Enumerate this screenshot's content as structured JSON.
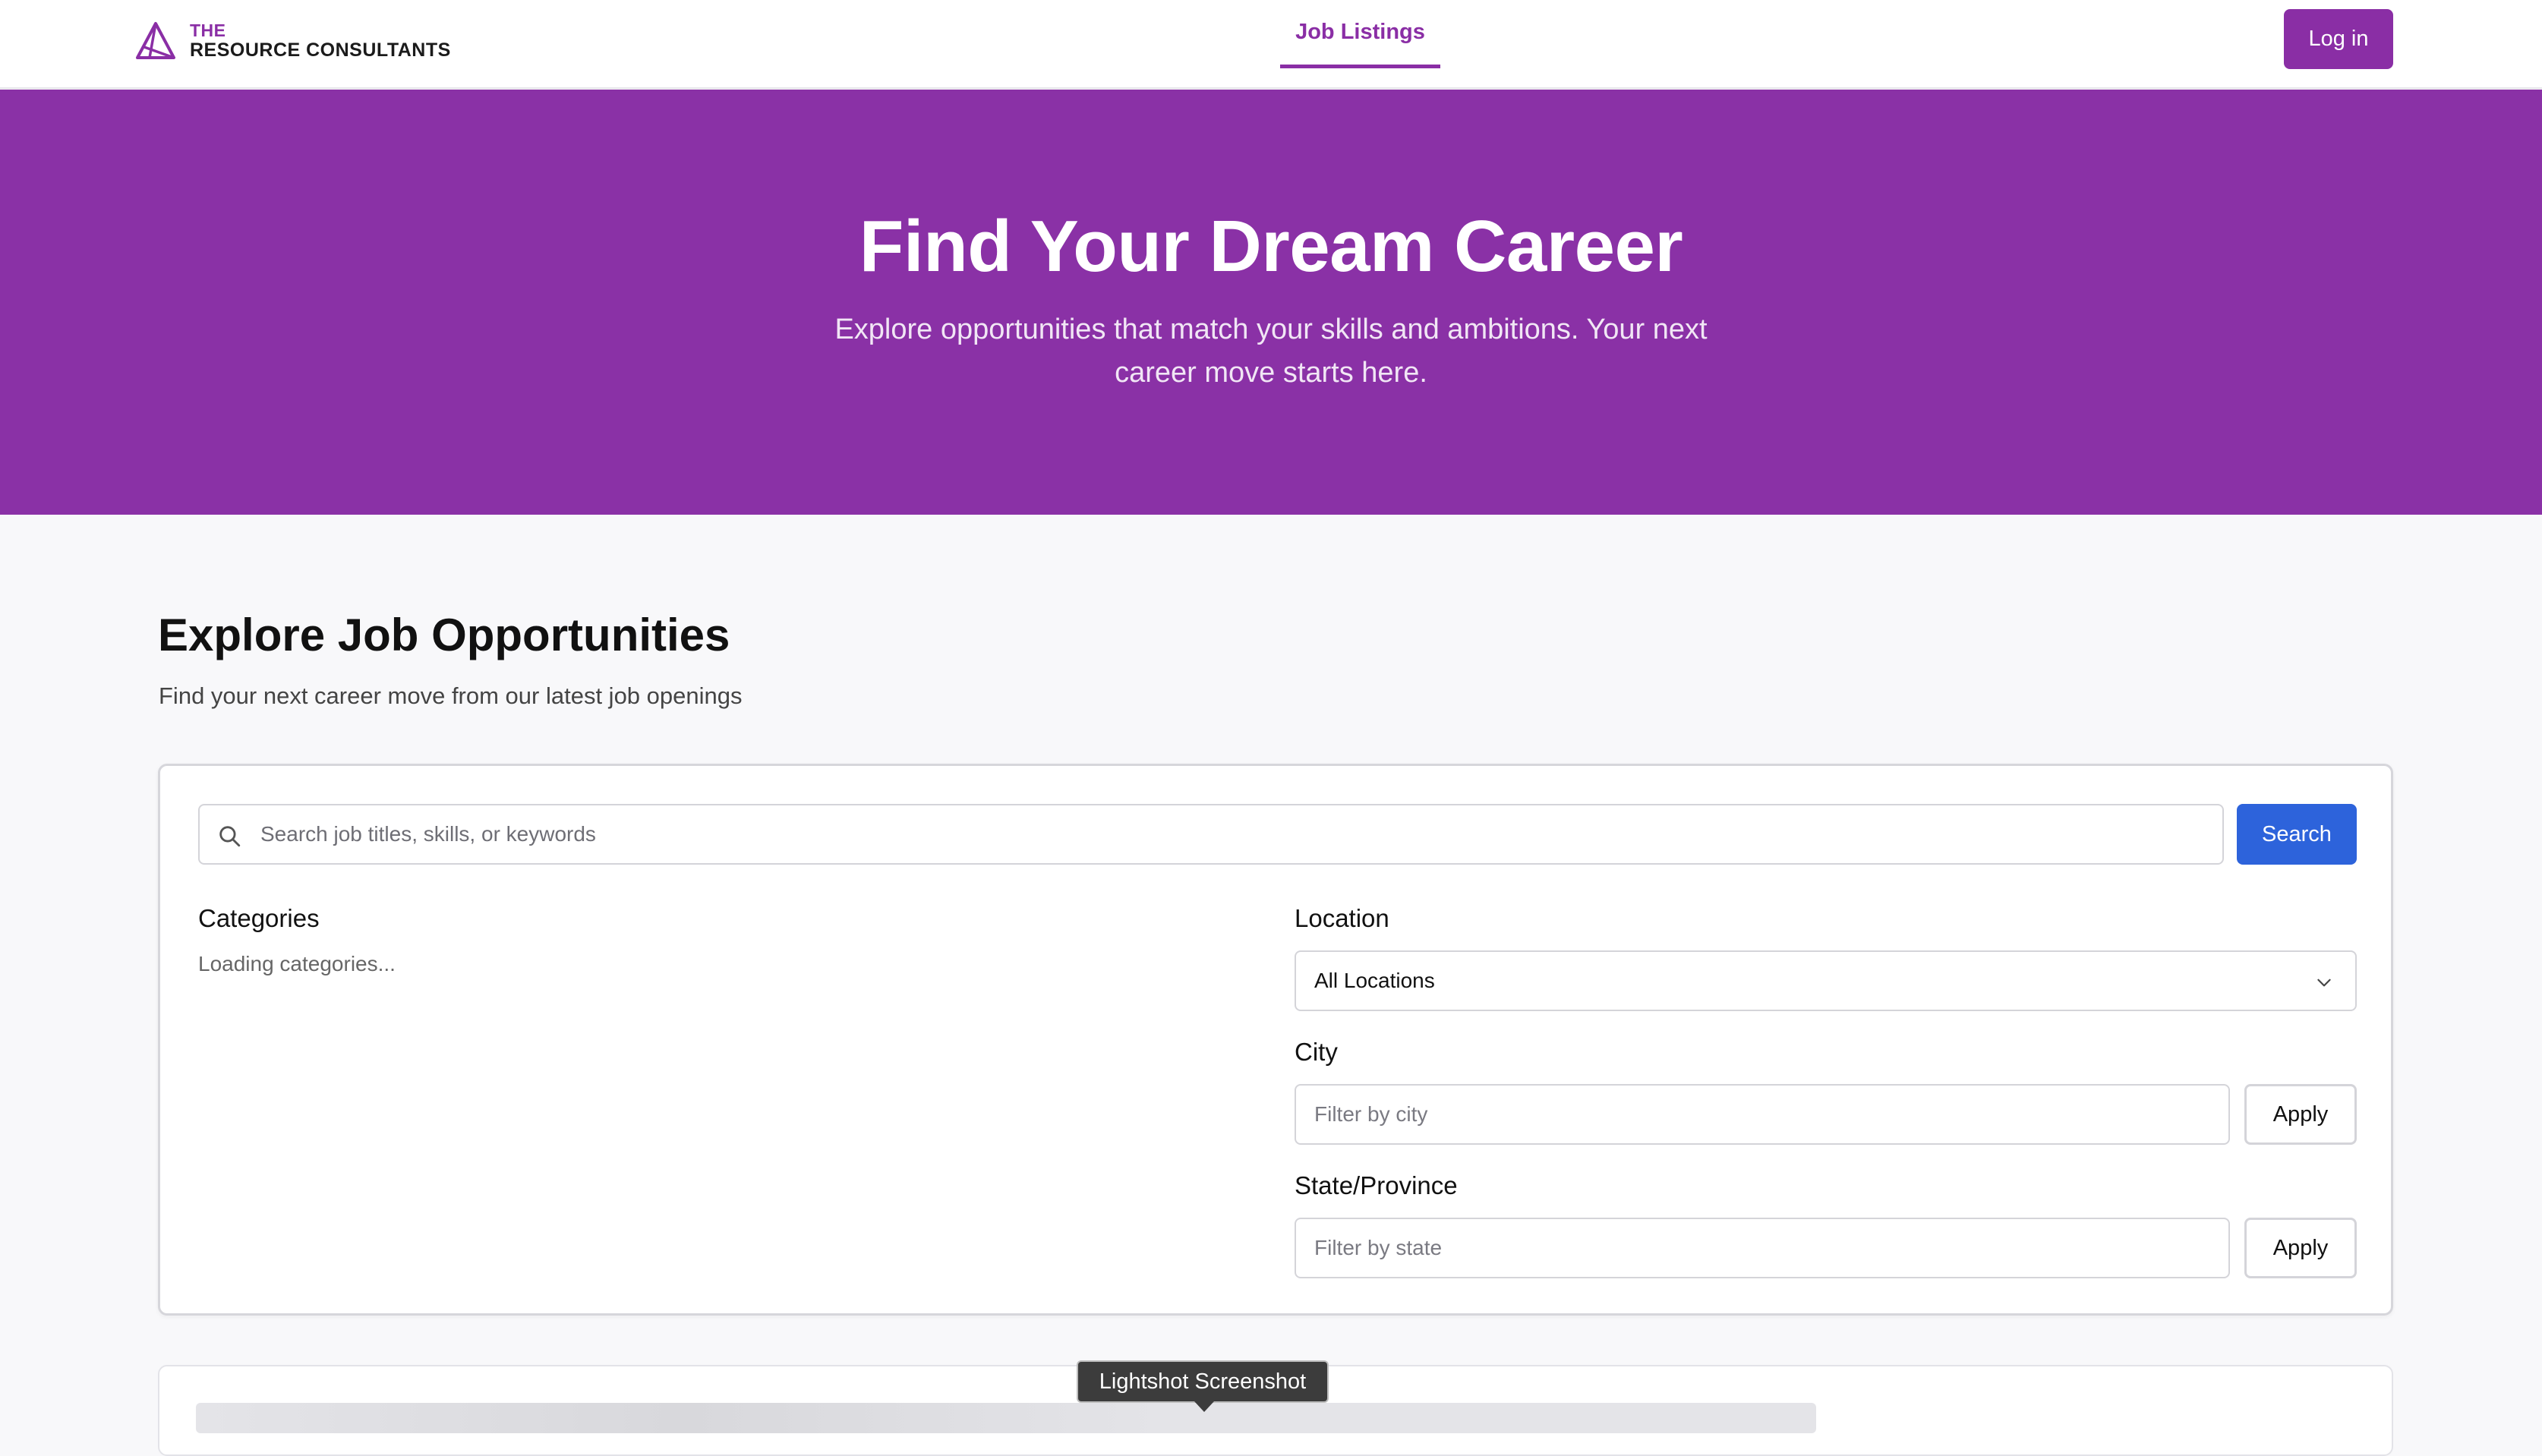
{
  "header": {
    "logo_line1": "THE",
    "logo_line2": "RESOURCE CONSULTANTS",
    "nav_tab": "Job Listings",
    "login_label": "Log in"
  },
  "hero": {
    "title": "Find Your Dream Career",
    "subtitle": "Explore opportunities that match your skills and ambitions. Your next career move starts here."
  },
  "section": {
    "title": "Explore Job Opportunities",
    "subtitle": "Find your next career move from our latest job openings"
  },
  "filters": {
    "search_placeholder": "Search job titles, skills, or keywords",
    "search_value": "",
    "search_button": "Search",
    "categories_label": "Categories",
    "categories_loading": "Loading categories...",
    "location_label": "Location",
    "location_selected": "All Locations",
    "city_label": "City",
    "city_placeholder": "Filter by city",
    "city_apply": "Apply",
    "state_label": "State/Province",
    "state_placeholder": "Filter by state",
    "state_apply": "Apply"
  },
  "overlay": {
    "tooltip": "Lightshot Screenshot"
  },
  "colors": {
    "brand_purple": "#8a2ea5",
    "hero_bg": "#8a31a6",
    "search_blue": "#2d63db"
  }
}
